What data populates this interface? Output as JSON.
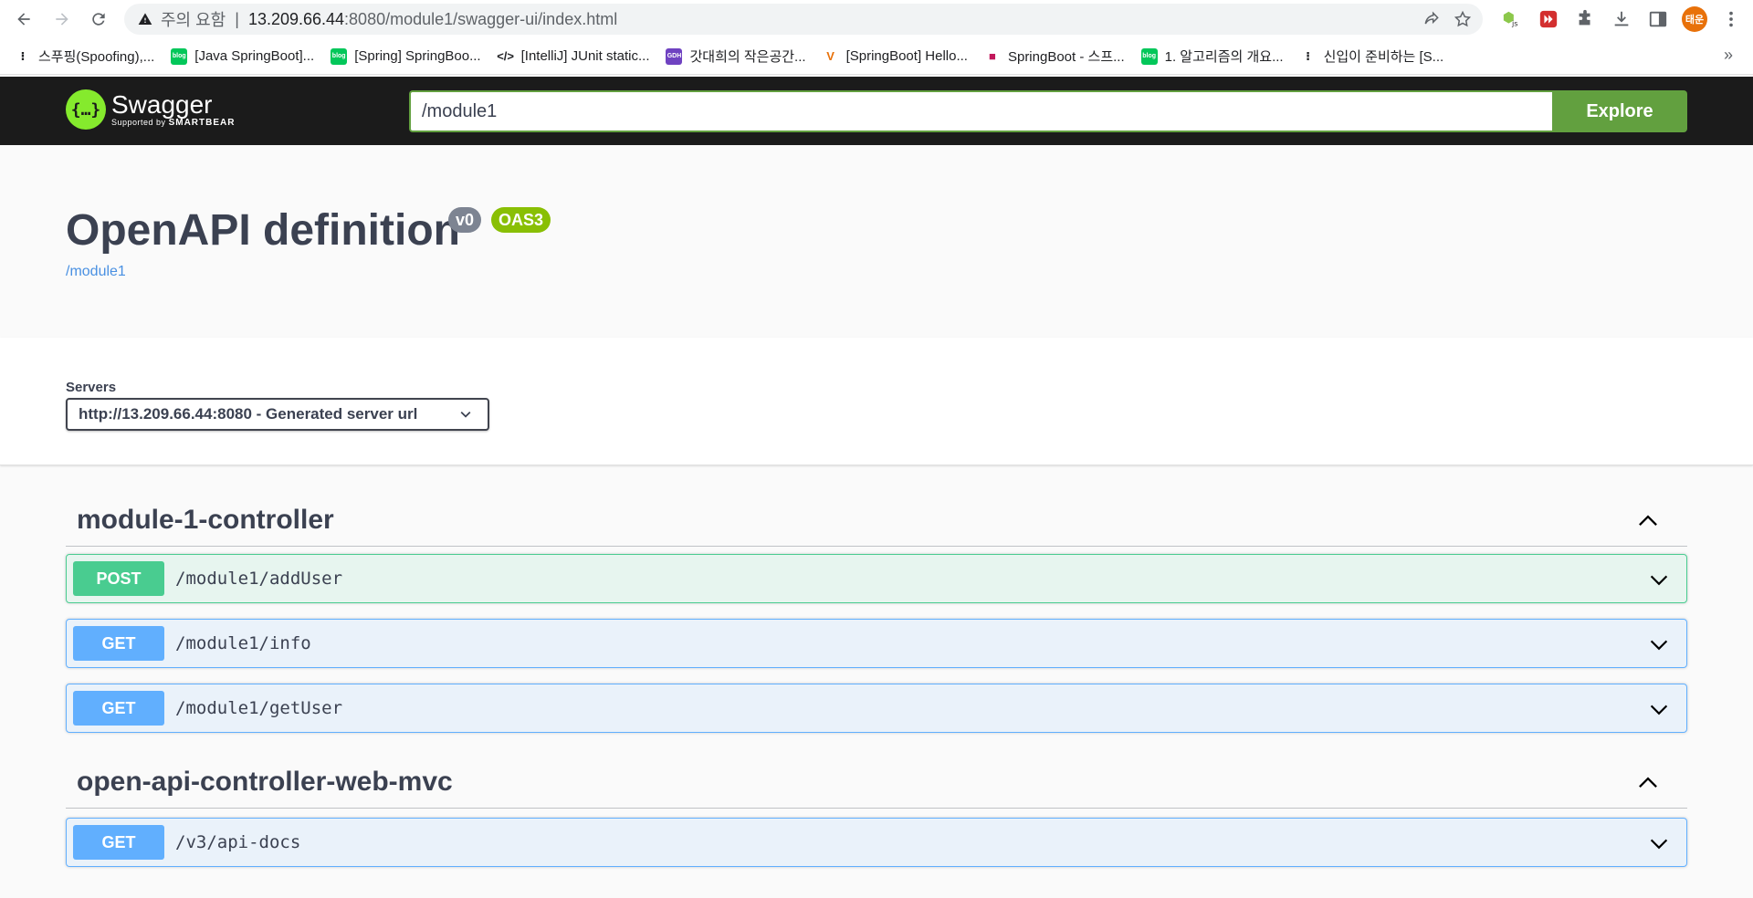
{
  "browser": {
    "warning_text": "주의 요함",
    "url_host": "13.209.66.44",
    "url_rest": ":8080/module1/swagger-ui/index.html",
    "avatar_text": "태운",
    "bookmarks": [
      {
        "label": "스푸핑(Spoofing),...",
        "icon": "tistory-icon",
        "color": "#202124"
      },
      {
        "label": "[Java SpringBoot]...",
        "icon": "blog-icon",
        "color": "#03c75a"
      },
      {
        "label": "[Spring] SpringBoo...",
        "icon": "blog-icon",
        "color": "#03c75a"
      },
      {
        "label": "[IntelliJ] JUnit static...",
        "icon": "code-icon",
        "color": "#202124"
      },
      {
        "label": "갓대희의 작은공간...",
        "icon": "gdh-icon",
        "color": "#6f42c1"
      },
      {
        "label": "[SpringBoot] Hello...",
        "icon": "velog-icon",
        "color": "#e8710a"
      },
      {
        "label": "SpringBoot - 스프...",
        "icon": "favicon-icon",
        "color": "#c2185b"
      },
      {
        "label": "1. 알고리즘의 개요...",
        "icon": "blog-icon",
        "color": "#03c75a"
      },
      {
        "label": "신입이 준비하는 [S...",
        "icon": "tistory-icon",
        "color": "#202124"
      }
    ],
    "more": "»"
  },
  "topbar": {
    "logo_title": "Swagger",
    "logo_sub_prefix": "Supported by",
    "logo_sub_brand": "SMARTBEAR",
    "explore_value": "/module1",
    "explore_label": "Explore"
  },
  "info": {
    "title": "OpenAPI definition",
    "version": "v0",
    "oas": "OAS3",
    "base_url": "/module1"
  },
  "servers": {
    "label": "Servers",
    "selected": "http://13.209.66.44:8080 - Generated server url"
  },
  "tags": [
    {
      "name": "module-1-controller",
      "operations": [
        {
          "method": "POST",
          "path": "/module1/addUser"
        },
        {
          "method": "GET",
          "path": "/module1/info"
        },
        {
          "method": "GET",
          "path": "/module1/getUser"
        }
      ]
    },
    {
      "name": "open-api-controller-web-mvc",
      "operations": [
        {
          "method": "GET",
          "path": "/v3/api-docs"
        }
      ]
    }
  ],
  "colors": {
    "post": "#49cc90",
    "get": "#61affe",
    "explore": "#62a03f",
    "logo": "#85ea2d"
  }
}
